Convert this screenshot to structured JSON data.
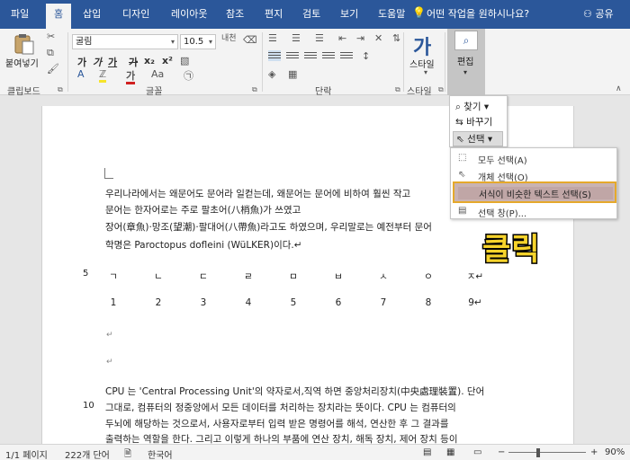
{
  "tabs": [
    "파일",
    "홈",
    "삽입",
    "디자인",
    "레이아웃",
    "참조",
    "편지",
    "검토",
    "보기",
    "도움말"
  ],
  "tell_me": "어떤 작업을 원하시나요?",
  "share": "공유",
  "ribbon": {
    "clipboard": {
      "paste": "붙여넣기",
      "label": "클립보드"
    },
    "font": {
      "name": "굴림",
      "size": "10.5",
      "label": "글꼴",
      "bold": "가",
      "italic": "가",
      "underline": "가",
      "strike": "가",
      "sub": "x₂",
      "sup": "x²",
      "case": "Aa",
      "clear": "가"
    },
    "paragraph": {
      "label": "단락"
    },
    "styles": {
      "button": "스타일",
      "label": "스타일"
    },
    "editing": {
      "button": "편집"
    }
  },
  "edit_menu": {
    "find": "찾기",
    "replace": "바꾸기",
    "select": "선택"
  },
  "select_menu": {
    "items": [
      "모두 선택(A)",
      "개체 선택(O)",
      "서식이 비슷한 텍스트 선택(S)",
      "선택 창(P)..."
    ]
  },
  "annotation": "클릭",
  "document": {
    "para1": [
      "우리나라에서는 왜문어도 문어라 일컫는데, 왜문어는 문어에 비하여 훨씬 작고",
      "문어는 한자어로는 주로 팔초어(八梢魚)가 쓰였고",
      "장어(章魚)·망조(望潮)·팔대어(八帶魚)라고도 하였으며, 우리말로는 예전부터 문어",
      "학명은 Paroctopus dofleini (WüLKER)이다.↵"
    ],
    "table_row1": [
      "ㄱ",
      "ㄴ",
      "ㄷ",
      "ㄹ",
      "ㅁ",
      "ㅂ",
      "ㅅ",
      "ㅇ",
      "ㅈ↵"
    ],
    "table_row2": [
      "1",
      "2",
      "3",
      "4",
      "5",
      "6",
      "7",
      "8",
      "9↵"
    ],
    "line_num_5": "5",
    "line_num_10": "10",
    "para2": [
      "CPU 는 'Central Processing Unit'의 약자로서,직역 하면 중앙처리장치(中央處理裝置). 단어",
      "그대로, 컴퓨터의 정중앙에서 모든 데이터를 처리하는 장치라는 뜻이다. CPU 는 컴퓨터의",
      "두뇌에 해당하는 것으로서, 사용자로부터 입력 받은 명령어를 해석, 연산한 후 그 결과를",
      "출력하는 역할을 한다. 그리고 이렇게 하나의 부품에 연산 장치, 해독 장치, 제어 장치 등이"
    ]
  },
  "status": {
    "page": "1/1 페이지",
    "words": "222개 단어",
    "lang": "한국어",
    "zoom": "90%"
  }
}
